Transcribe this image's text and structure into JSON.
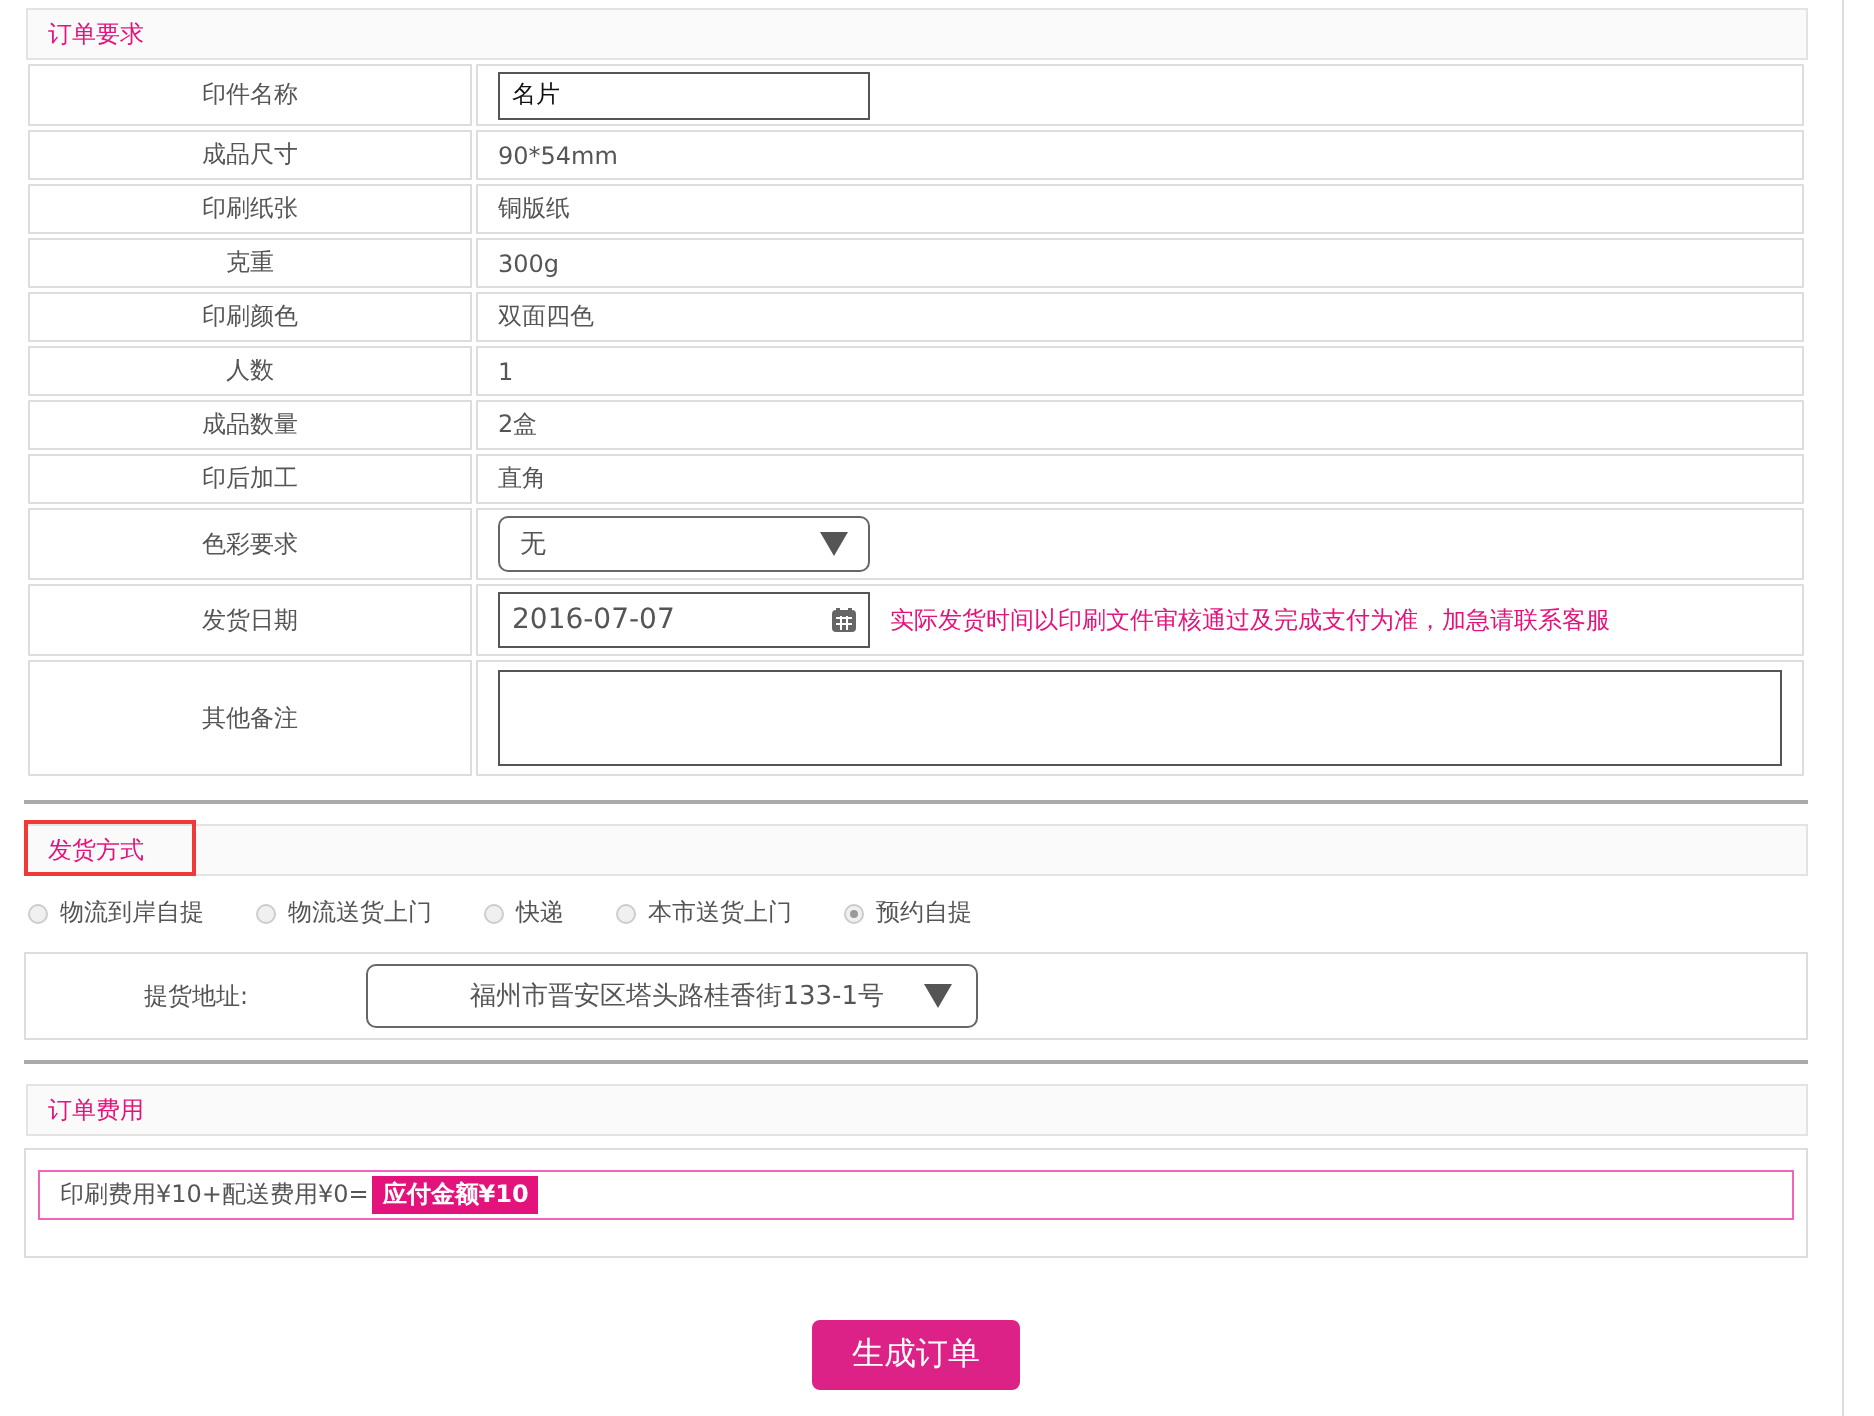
{
  "order_requirements": {
    "title": "订单要求",
    "rows": [
      {
        "label": "印件名称",
        "kind": "input",
        "value": "名片"
      },
      {
        "label": "成品尺寸",
        "kind": "text",
        "value": "90*54mm"
      },
      {
        "label": "印刷纸张",
        "kind": "text",
        "value": "铜版纸"
      },
      {
        "label": "克重",
        "kind": "text",
        "value": "300g"
      },
      {
        "label": "印刷颜色",
        "kind": "text",
        "value": "双面四色"
      },
      {
        "label": "人数",
        "kind": "text",
        "value": "1"
      },
      {
        "label": "成品数量",
        "kind": "text",
        "value": "2盒"
      },
      {
        "label": "印后加工",
        "kind": "text",
        "value": "直角"
      },
      {
        "label": "色彩要求",
        "kind": "select",
        "value": "无"
      },
      {
        "label": "发货日期",
        "kind": "date",
        "value": "2016-07-07",
        "note": "实际发货时间以印刷文件审核通过及完成支付为准，加急请联系客服"
      },
      {
        "label": "其他备注",
        "kind": "textarea"
      }
    ]
  },
  "delivery": {
    "title": "发货方式",
    "highlighted": true,
    "options": [
      {
        "label": "物流到岸自提",
        "selected": false
      },
      {
        "label": "物流送货上门",
        "selected": false
      },
      {
        "label": "快递",
        "selected": false
      },
      {
        "label": "本市送货上门",
        "selected": false
      },
      {
        "label": "预约自提",
        "selected": true
      }
    ],
    "address_label": "提货地址:",
    "address": "福州市晋安区塔头路桂香街133-1号"
  },
  "fees": {
    "title": "订单费用",
    "formula": "印刷费用¥10+配送费用¥0=",
    "total": "应付金额¥10"
  },
  "submit_button": "生成订单"
}
